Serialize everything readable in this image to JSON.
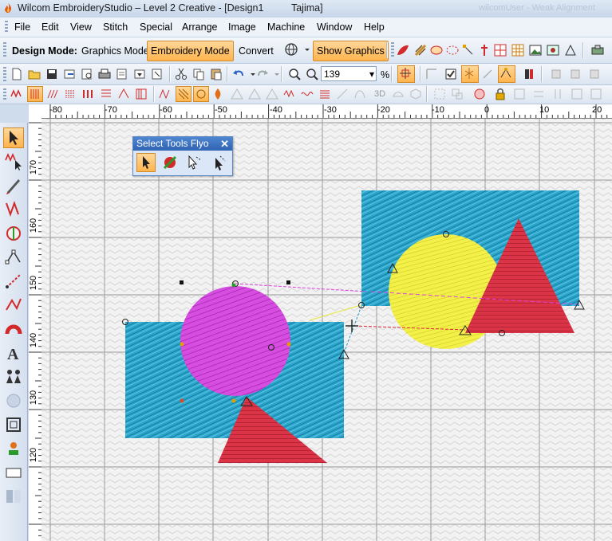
{
  "window": {
    "title": "Wilcom EmbroideryStudio – Level 2 Creative - [Design1          Tajima]",
    "faint_text": "wilcomUser - Weak Alignment"
  },
  "menu": [
    {
      "label": "File"
    },
    {
      "label": "Edit"
    },
    {
      "label": "View"
    },
    {
      "label": "Stitch"
    },
    {
      "label": "Special"
    },
    {
      "label": "Arrange"
    },
    {
      "label": "Image"
    },
    {
      "label": "Machine"
    },
    {
      "label": "Window"
    },
    {
      "label": "Help"
    }
  ],
  "design_mode": {
    "label": "Design Mode:",
    "graphics_mode": "Graphics Mode",
    "embroidery_mode": "Embroidery Mode",
    "convert": "Convert",
    "show_graphics": "Show Graphics"
  },
  "zoom": {
    "value": "139",
    "unit": "%"
  },
  "ruler": {
    "h_labels": [
      "-80",
      "-70",
      "-60",
      "-50",
      "-40",
      "-30",
      "-20",
      "-10",
      "0",
      "10",
      "20"
    ],
    "v_labels": [
      "170",
      "160",
      "150",
      "140",
      "130",
      "120"
    ]
  },
  "flyout": {
    "title": "Select Tools Flyo",
    "close": "✕"
  },
  "colors": {
    "accent": "#ffb44d",
    "fabric_blue": "#1f9cc4",
    "magenta": "#d23ad8",
    "yellow": "#f2ee3a",
    "red": "#d8283a"
  }
}
